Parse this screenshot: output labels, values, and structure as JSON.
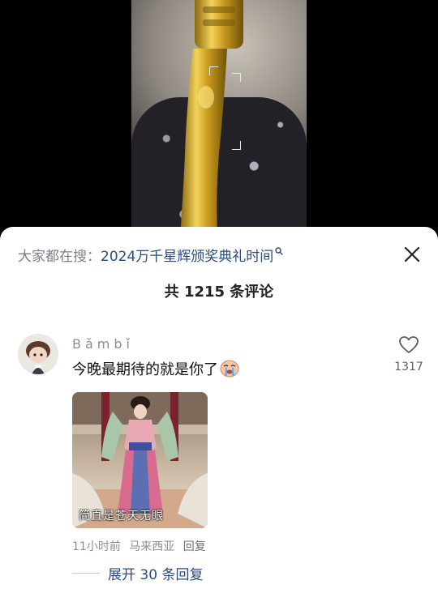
{
  "search": {
    "prefix": "大家都在搜：",
    "query": "2024万千星辉颁奖典礼时间",
    "icon": "search-icon"
  },
  "sheet": {
    "title": "共 1215 条评论",
    "close_icon": "close-icon"
  },
  "comment": {
    "username": "Bǎmbǐ",
    "text": "今晚最期待的就是你了",
    "emoji": "crying-face-emoji",
    "like_count": "1317",
    "image_caption": "简直是苍天无眼",
    "time": "11小时前",
    "location": "马来西亚",
    "reply_label": "回复",
    "expand_label": "展开 30 条回复"
  },
  "colors": {
    "accent": "#2b4c7e",
    "muted": "#8d8f94",
    "background": "#ffffff"
  }
}
